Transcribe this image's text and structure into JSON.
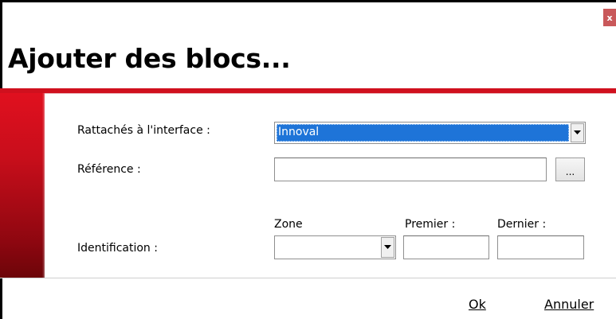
{
  "dialog": {
    "title": "Ajouter des blocs...",
    "close_label": "x"
  },
  "form": {
    "interface_label": "Rattachés à l'interface :",
    "interface_value": "Innoval",
    "reference_label": "Référence :",
    "reference_value": "",
    "browse_label": "...",
    "zone_label": "Zone",
    "premier_label": "Premier :",
    "dernier_label": "Dernier :",
    "identification_label": "Identification :",
    "zone_value": "",
    "premier_value": "",
    "dernier_value": ""
  },
  "footer": {
    "ok_label": "Ok",
    "cancel_label": "Annuler"
  },
  "colors": {
    "accent_red": "#d0101e",
    "selection_blue": "#1e74d8",
    "close_button": "#c9585a"
  }
}
